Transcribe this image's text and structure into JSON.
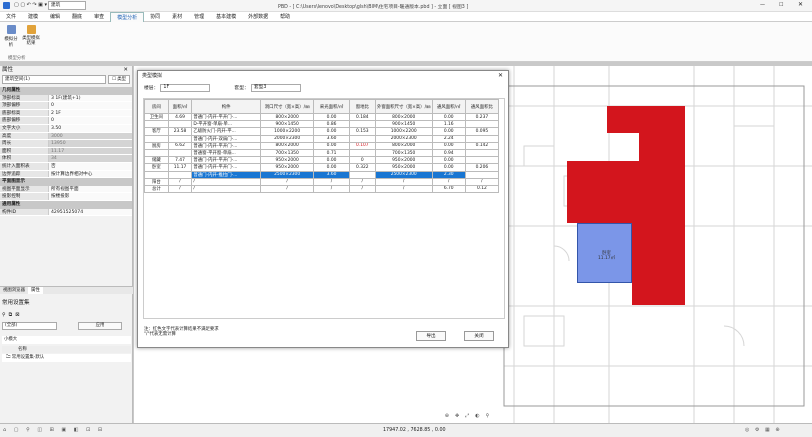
{
  "titlebar": {
    "project": "建筑",
    "path": "PBD - [ C:\\Users\\lenovo\\Desktop\\glsh\\BIM\\住宅项目-暖通版本.pbd ] - 立面 [ 视图3 ]"
  },
  "menu": [
    "文件",
    "建模",
    "编辑",
    "翻底",
    "审查",
    "模型分析",
    "协同",
    "素材",
    "管理",
    "基本建模",
    "外部数据",
    "帮助"
  ],
  "menu_active": "模型分析",
  "ribbon": {
    "btn1": "模拟分析",
    "btn2": "类型模拟结果",
    "group": "模型分析"
  },
  "left": {
    "props_title": "属性",
    "props_type": "建筑空间(1)",
    "props_edit": "☐ 类型",
    "sec1": "几何属性",
    "rows1": [
      {
        "k": "顶部标高",
        "v": "3 1F(建筑+1)"
      },
      {
        "k": "顶部偏移",
        "v": "0"
      },
      {
        "k": "底部标高",
        "v": "2 1F"
      },
      {
        "k": "底部偏移",
        "v": "0"
      },
      {
        "k": "文字大小",
        "v": "3.50"
      }
    ],
    "rows_grey": [
      {
        "k": "高度",
        "v": "3000"
      },
      {
        "k": "周长",
        "v": "13950"
      },
      {
        "k": "面积",
        "v": "11.17"
      },
      {
        "k": "体积",
        "v": "34"
      }
    ],
    "rows2": [
      {
        "k": "统计入面积表",
        "v": "否"
      },
      {
        "k": "边界追踪",
        "v": "按计算边界相对中心"
      }
    ],
    "sec2": "平面图显示",
    "rows3": [
      {
        "k": "视图平面显示",
        "v": "所有视图平面"
      },
      {
        "k": "投影控制",
        "v": "按楼投影"
      }
    ],
    "sec3": "通用属性",
    "rows4": [
      {
        "k": "构件ID",
        "v": "42951525074"
      }
    ],
    "tabs": [
      "视图浏览器",
      "属性"
    ],
    "common_title": "常用设置集",
    "apply": "应用",
    "filter": "(全部)",
    "col_name": "名称",
    "common_item": "常用设置集-默认",
    "small": "小模大"
  },
  "dialog": {
    "title": "类型模拟",
    "floor_label": "楼层：",
    "floor": "1F",
    "type_label": "套型：",
    "type": "套型3",
    "headers": [
      "房间",
      "面积/㎡",
      "构件",
      "洞口尺寸（宽×高）/㎜",
      "采光面积/㎡",
      "窗地比",
      "外窗面积尺寸（宽×高）/㎜",
      "通风面积/㎡",
      "通风面积比"
    ],
    "rows": [
      {
        "room": "卫生间",
        "area": "4.69",
        "comp": "普通门-内开-平开门-...",
        "size": "800×2000",
        "light": "0.00",
        "ratio": "0.184",
        "win": "800×2000",
        "vent": "0.00",
        "vratio": "0.237"
      },
      {
        "room": "",
        "area": "",
        "comp": "D-平开窗-单扇-单...",
        "size": "900×1450",
        "light": "0.86",
        "ratio": "",
        "win": "900×1450",
        "vent": "1.16",
        "vratio": ""
      },
      {
        "room": "客厅",
        "area": "23.58",
        "comp": "乙级防火门-内开-平...",
        "size": "1000×2200",
        "light": "0.00",
        "ratio": "0.153",
        "win": "1000×2200",
        "vent": "0.00",
        "vratio": "0.095"
      },
      {
        "room": "",
        "area": "",
        "comp": "普通门-内开-双扇门-...",
        "size": "2000×2300",
        "light": "3.60",
        "ratio": "",
        "win": "2000×2300",
        "vent": "2.24",
        "vratio": ""
      },
      {
        "room": "厨房",
        "area": "6.62",
        "comp": "普通门-内开-平开门-...",
        "size": "800×2000",
        "light": "0.00",
        "ratio": "0.107",
        "win": "800×2000",
        "vent": "0.00",
        "vratio": "0.142"
      },
      {
        "room": "",
        "area": "",
        "comp": "普通窗-平开窗-单扇...",
        "size": "700×1350",
        "light": "0.71",
        "ratio": "",
        "win": "700×1350",
        "vent": "0.94",
        "vratio": ""
      },
      {
        "room": "储藏",
        "area": "7.47",
        "comp": "普通门-内开-平开门-...",
        "size": "950×2000",
        "light": "0.00",
        "ratio": "0",
        "win": "950×2000",
        "vent": "0.00",
        "vratio": ""
      },
      {
        "room": "卧室",
        "area": "11.17",
        "comp": "普通门-内开-平开门-...",
        "size": "950×2000",
        "light": "0.00",
        "ratio": "0.322",
        "win": "950×2000",
        "vent": "0.00",
        "vratio": "0.206"
      },
      {
        "room": "",
        "area": "",
        "comp": "普通门-内开-推拉门-...",
        "size": "2500×2300",
        "light": "3.60",
        "ratio": "",
        "win": "2500×2300",
        "vent": "2.30",
        "vratio": ""
      },
      {
        "room": "阳台",
        "area": "/",
        "comp": "/",
        "size": "/",
        "light": "/",
        "ratio": "/",
        "win": "/",
        "vent": "/",
        "vratio": "/"
      },
      {
        "room": "总计",
        "area": "/",
        "comp": "/",
        "size": "/",
        "light": "/",
        "ratio": "/",
        "win": "/",
        "vent": "6.70",
        "vratio": "0.12"
      }
    ],
    "note1": "注：红色文字代表计算结果不满足要求",
    "note2": "\"/\"代表无需计算",
    "export": "导出",
    "close": "关闭"
  },
  "canvas": {
    "room_label": "卧室",
    "room_area": "11.17㎡"
  },
  "status": {
    "coords": "17947.02 , 7628.85 , 0.00"
  },
  "colors": {
    "red": "#d3151d",
    "select": "#1976d2",
    "room": "#7b96e8"
  }
}
